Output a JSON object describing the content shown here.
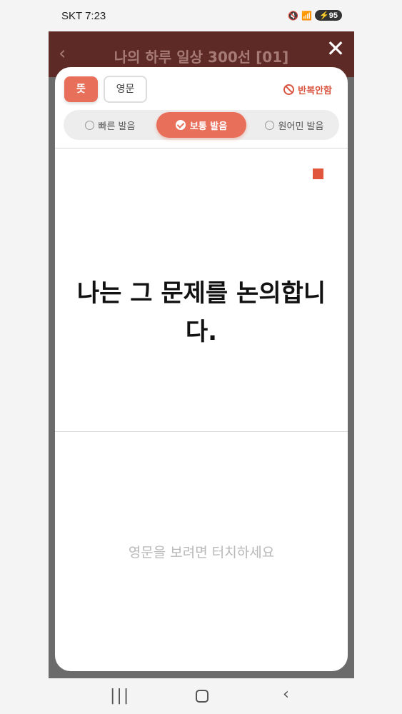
{
  "status_bar": {
    "time": "SKT 7:23",
    "icons": [
      "mute-icon",
      "wifi-icon",
      "signal-icon"
    ],
    "battery": "95"
  },
  "app": {
    "title": "나의 하루 일상 300선 [01]"
  },
  "modal": {
    "tab_meaning": "뜻",
    "tab_english": "영문",
    "no_repeat_label": "반복안함",
    "speed_options": [
      "빠른 발음",
      "보통 발음",
      "원어민 발음"
    ],
    "selected_speed": "보통 발음",
    "sentence": "나는 그 문제를 논의합니다.",
    "hint": "영문을 보려면 터치하세요"
  },
  "colors": {
    "accent": "#e8705b",
    "stop": "#e2553d",
    "hint": "#b8b8b8"
  }
}
